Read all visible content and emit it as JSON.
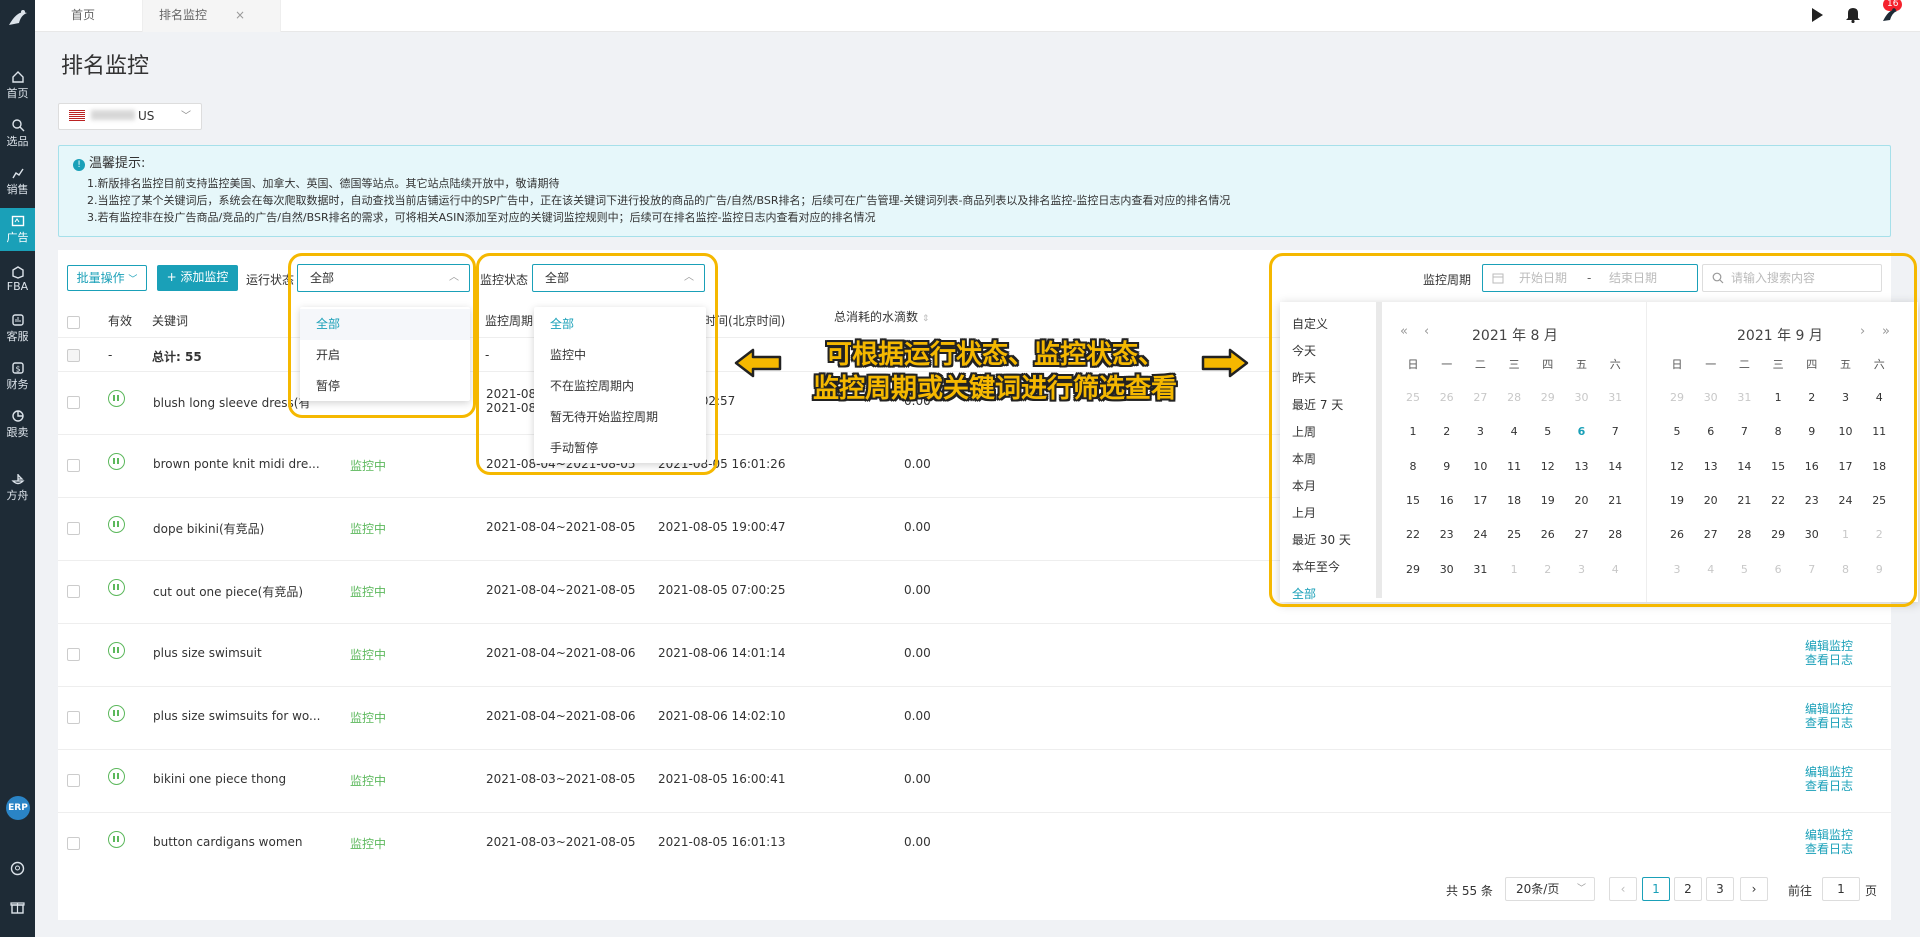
{
  "sidebar": {
    "items": [
      {
        "label": "首页",
        "icon": "home-icon"
      },
      {
        "label": "选品",
        "icon": "search-icon"
      },
      {
        "label": "销售",
        "icon": "chart-icon"
      },
      {
        "label": "广告",
        "icon": "ad-icon"
      },
      {
        "label": "FBA",
        "icon": "box-icon"
      },
      {
        "label": "客服",
        "icon": "service-icon"
      },
      {
        "label": "财务",
        "icon": "finance-icon"
      },
      {
        "label": "跟卖",
        "icon": "pie-icon"
      },
      {
        "label": "方舟",
        "icon": "ark-icon"
      }
    ],
    "erp": "ERP",
    "active_color": "#1aa0b8"
  },
  "tabs": [
    {
      "label": "首页"
    },
    {
      "label": "排名监控",
      "close": "×"
    }
  ],
  "notifications": {
    "count": "16"
  },
  "page": {
    "title": "排名监控",
    "site": "US"
  },
  "notice": {
    "title": "温馨提示:",
    "lines": [
      "1.新版排名监控目前支持监控美国、加拿大、英国、德国等站点。其它站点陆续开放中，敬请期待",
      "2.当监控了某个关键词后，系统会在每次爬取数据时，自动查找当前店铺运行中的SP广告中，正在该关键词下进行投放的商品的广告/自然/BSR排名；后续可在广告管理-关键词列表-商品列表以及排名监控-监控日志内查看对应的排名情况",
      "3.若有监控非在投广告商品/竞品的广告/自然/BSR排名的需求，可将相关ASIN添加至对应的关键词监控规则中；后续可在排名监控-监控日志内查看对应的排名情况"
    ]
  },
  "toolbar": {
    "batch": "批量操作",
    "add": "+ 添加监控",
    "run_status_label": "运行状态",
    "run_status_value": "全部",
    "monitor_status_label": "监控状态",
    "monitor_status_value": "全部",
    "period_label": "监控周期",
    "date_start": "开始日期",
    "date_sep": "-",
    "date_end": "结束日期",
    "search_placeholder": "请输入搜索内容"
  },
  "table": {
    "headers": [
      "有效",
      "关键词",
      "监控周期",
      "时间(北京时间)",
      "总消耗的水滴数"
    ],
    "summary": {
      "dash": "-",
      "label": "总计: 55",
      "period": "-"
    },
    "rows": [
      {
        "keyword": "blush long sleeve dress(有",
        "status": "",
        "period": "2021-08",
        "period2": "2021-08",
        "time": "-05 16:02:57",
        "cost": "0.00"
      },
      {
        "keyword": "brown ponte knit midi dre...",
        "status": "监控中",
        "period": "2021-08-04~2021-08-05",
        "time": "2021-08-05 16:01:26",
        "cost": "0.00"
      },
      {
        "keyword": "dope bikini(有竞品)",
        "status": "监控中",
        "period": "2021-08-04~2021-08-05",
        "time": "2021-08-05 19:00:47",
        "cost": "0.00"
      },
      {
        "keyword": "cut out one piece(有竞品)",
        "status": "监控中",
        "period": "2021-08-04~2021-08-05",
        "time": "2021-08-05 07:00:25",
        "cost": "0.00"
      },
      {
        "keyword": "plus size swimsuit",
        "status": "监控中",
        "period": "2021-08-04~2021-08-06",
        "time": "2021-08-06 14:01:14",
        "cost": "0.00",
        "op1": "编辑监控",
        "op2": "查看日志"
      },
      {
        "keyword": "plus size swimsuits for wo...",
        "status": "监控中",
        "period": "2021-08-04~2021-08-06",
        "time": "2021-08-06 14:02:10",
        "cost": "0.00",
        "op1": "编辑监控",
        "op2": "查看日志"
      },
      {
        "keyword": "bikini one piece thong",
        "status": "监控中",
        "period": "2021-08-03~2021-08-05",
        "time": "2021-08-05 16:00:41",
        "cost": "0.00",
        "op1": "编辑监控",
        "op2": "查看日志"
      },
      {
        "keyword": "button cardigans women",
        "status": "监控中",
        "period": "2021-08-03~2021-08-05",
        "time": "2021-08-05 16:01:13",
        "cost": "0.00",
        "op1": "编辑监控",
        "op2": "查看日志"
      }
    ]
  },
  "pagination": {
    "total": "共 55 条",
    "size": "20条/页",
    "pages": [
      "1",
      "2",
      "3"
    ],
    "prev": "‹",
    "next": "›",
    "goto_label": "前往",
    "goto_value": "1",
    "goto_suffix": "页"
  },
  "run_status_options": [
    "全部",
    "开启",
    "暂停"
  ],
  "monitor_status_options": [
    "全部",
    "监控中",
    "不在监控周期内",
    "暂无待开始监控周期",
    "手动暂停"
  ],
  "calendar": {
    "shortcuts": [
      "自定义",
      "今天",
      "昨天",
      "最近 7 天",
      "上周",
      "本周",
      "本月",
      "上月",
      "最近 30 天",
      "本年至今",
      "全部"
    ],
    "weekdays": [
      "日",
      "一",
      "二",
      "三",
      "四",
      "五",
      "六"
    ],
    "left": {
      "title": "2021 年 8 月",
      "days": [
        "25",
        "26",
        "27",
        "28",
        "29",
        "30",
        "31",
        "1",
        "2",
        "3",
        "4",
        "5",
        "6",
        "7",
        "8",
        "9",
        "10",
        "11",
        "12",
        "13",
        "14",
        "15",
        "16",
        "17",
        "18",
        "19",
        "20",
        "21",
        "22",
        "23",
        "24",
        "25",
        "26",
        "27",
        "28",
        "29",
        "30",
        "31",
        "1",
        "2",
        "3",
        "4"
      ]
    },
    "right": {
      "title": "2021 年 9 月",
      "days": [
        "29",
        "30",
        "31",
        "1",
        "2",
        "3",
        "4",
        "5",
        "6",
        "7",
        "8",
        "9",
        "10",
        "11",
        "12",
        "13",
        "14",
        "15",
        "16",
        "17",
        "18",
        "19",
        "20",
        "21",
        "22",
        "23",
        "24",
        "25",
        "26",
        "27",
        "28",
        "29",
        "30",
        "1",
        "2",
        "3",
        "4",
        "5",
        "6",
        "7",
        "8",
        "9"
      ]
    },
    "nav": {
      "prev_year": "«",
      "prev_month": "‹",
      "next_month": "›",
      "next_year": "»"
    }
  },
  "annotation": {
    "line1": "可根据运行状态、监控状态、",
    "line2": "监控周期或关键词进行筛选查看"
  },
  "colors": {
    "highlight": "#f5b800",
    "primary": "#1aa0b8",
    "running": "#5cb85c"
  }
}
